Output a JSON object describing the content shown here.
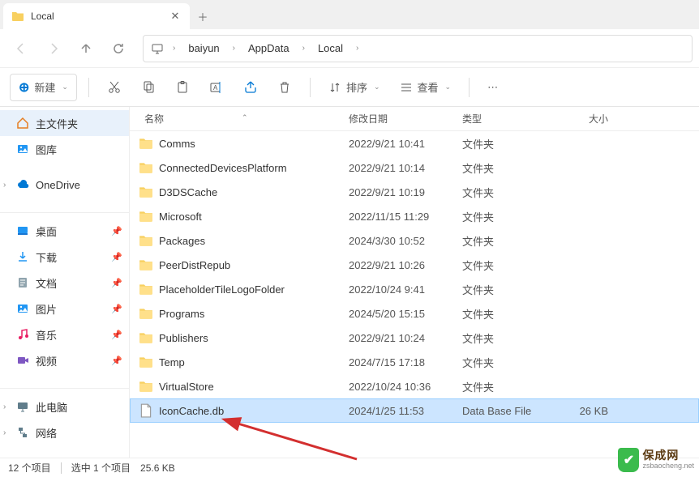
{
  "tab": {
    "title": "Local"
  },
  "breadcrumb": [
    "baiyun",
    "AppData",
    "Local"
  ],
  "toolbar": {
    "new_label": "新建",
    "sort_label": "排序",
    "view_label": "查看"
  },
  "sidebar": {
    "home": "主文件夹",
    "gallery": "图库",
    "onedrive": "OneDrive",
    "desktop": "桌面",
    "downloads": "下载",
    "documents": "文档",
    "pictures": "图片",
    "music": "音乐",
    "videos": "视频",
    "thispc": "此电脑",
    "network": "网络"
  },
  "columns": {
    "name": "名称",
    "date": "修改日期",
    "type": "类型",
    "size": "大小"
  },
  "folder_type": "文件夹",
  "files": [
    {
      "name": "Comms",
      "date": "2022/9/21 10:41",
      "type": "文件夹",
      "icon": "folder"
    },
    {
      "name": "ConnectedDevicesPlatform",
      "date": "2022/9/21 10:14",
      "type": "文件夹",
      "icon": "folder"
    },
    {
      "name": "D3DSCache",
      "date": "2022/9/21 10:19",
      "type": "文件夹",
      "icon": "folder"
    },
    {
      "name": "Microsoft",
      "date": "2022/11/15 11:29",
      "type": "文件夹",
      "icon": "folder"
    },
    {
      "name": "Packages",
      "date": "2024/3/30 10:52",
      "type": "文件夹",
      "icon": "folder"
    },
    {
      "name": "PeerDistRepub",
      "date": "2022/9/21 10:26",
      "type": "文件夹",
      "icon": "folder"
    },
    {
      "name": "PlaceholderTileLogoFolder",
      "date": "2022/10/24 9:41",
      "type": "文件夹",
      "icon": "folder"
    },
    {
      "name": "Programs",
      "date": "2024/5/20 15:15",
      "type": "文件夹",
      "icon": "folder"
    },
    {
      "name": "Publishers",
      "date": "2022/9/21 10:24",
      "type": "文件夹",
      "icon": "folder"
    },
    {
      "name": "Temp",
      "date": "2024/7/15 17:18",
      "type": "文件夹",
      "icon": "folder"
    },
    {
      "name": "VirtualStore",
      "date": "2022/10/24 10:36",
      "type": "文件夹",
      "icon": "folder"
    },
    {
      "name": "IconCache.db",
      "date": "2024/1/25 11:53",
      "type": "Data Base File",
      "size": "26 KB",
      "icon": "file",
      "selected": true
    }
  ],
  "status": {
    "count": "12 个项目",
    "selection": "选中 1 个项目",
    "selsize": "25.6 KB"
  },
  "watermark": {
    "cn": "保成网",
    "en": "zsbaocheng.net"
  }
}
